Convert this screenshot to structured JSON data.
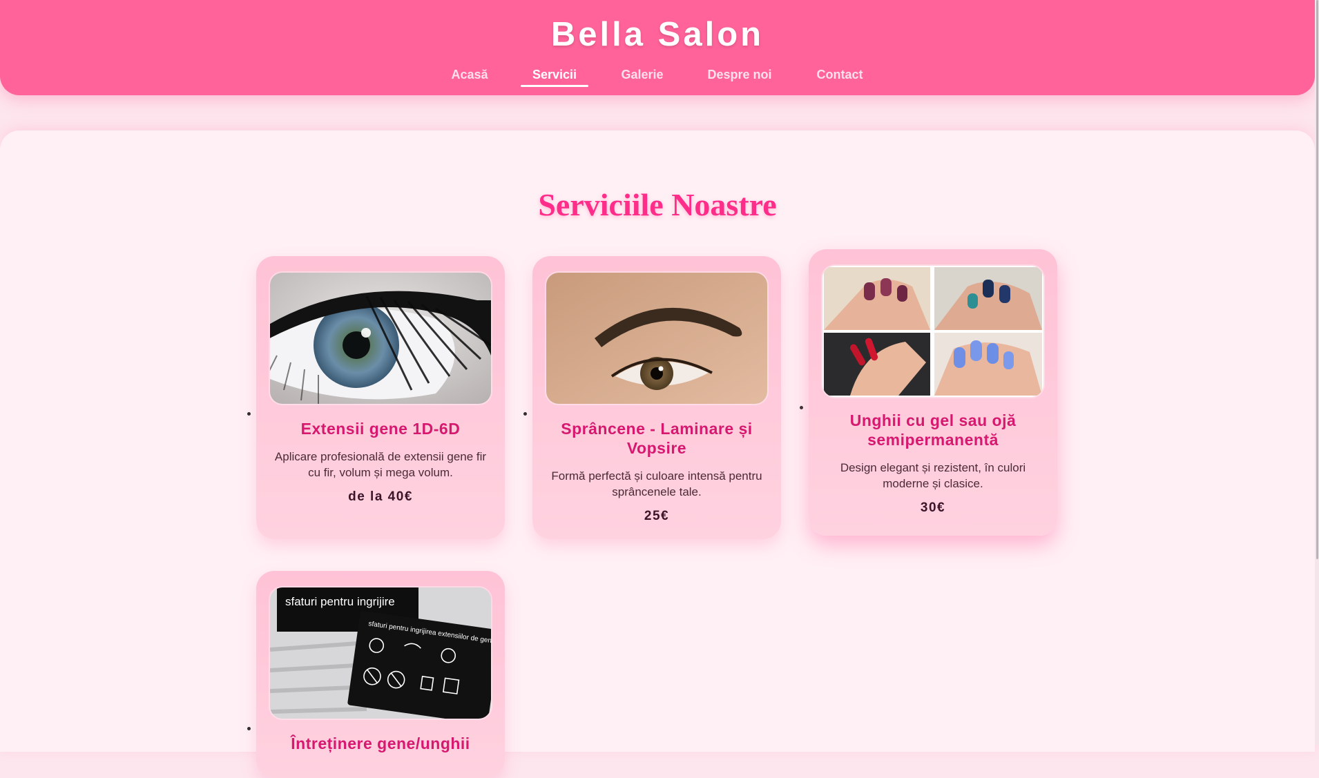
{
  "header": {
    "brand": "Bella Salon",
    "nav": [
      {
        "label": "Acasă",
        "active": false
      },
      {
        "label": "Servicii",
        "active": true
      },
      {
        "label": "Galerie",
        "active": false
      },
      {
        "label": "Despre noi",
        "active": false
      },
      {
        "label": "Contact",
        "active": false
      }
    ]
  },
  "services": {
    "title": "Serviciile Noastre",
    "cards": [
      {
        "title": "Extensii gene 1D-6D",
        "description": "Aplicare profesională de extensii gene fir cu fir, volum și mega volum.",
        "price": "de la 40€",
        "image": "eyelash-extensions-photo"
      },
      {
        "title": "Sprâncene - Laminare și Vopsire",
        "description": "Formă perfectă și culoare intensă pentru sprâncenele tale.",
        "price": "25€",
        "image": "eyebrow-lamination-photo"
      },
      {
        "title": "Unghii cu gel sau ojă semipermanentă",
        "description": "Design elegant și rezistent, în culori moderne și clasice.",
        "price": "30€",
        "image": "gel-nails-collage-photo"
      },
      {
        "title": "Întreținere gene/unghii",
        "image": "aftercare-tips-card-photo",
        "image_caption": "sfaturi pentru ingrijire",
        "image_card_heading": "sfaturi pentru ingrijirea extensiilor de gene"
      }
    ]
  },
  "colors": {
    "header": "#ff6399",
    "title": "#ff2d8a",
    "card_title": "#d6186f",
    "background": "#fde6ee"
  }
}
